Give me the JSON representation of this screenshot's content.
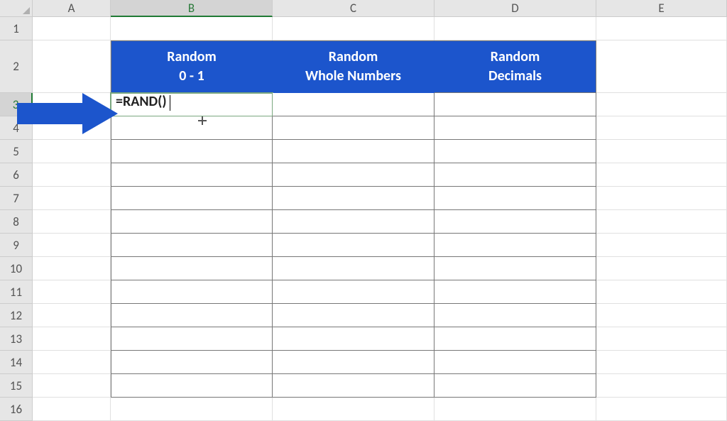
{
  "columns": {
    "A": "A",
    "B": "B",
    "C": "C",
    "D": "D",
    "E": "E"
  },
  "rows": {
    "r1": "1",
    "r2": "2",
    "r3": "3",
    "r4": "4",
    "r5": "5",
    "r6": "6",
    "r7": "7",
    "r8": "8",
    "r9": "9",
    "r10": "10",
    "r11": "11",
    "r12": "12",
    "r13": "13",
    "r14": "14",
    "r15": "15",
    "r16": "16"
  },
  "headers": {
    "B": {
      "line1": "Random",
      "line2": "0 - 1"
    },
    "C": {
      "line1": "Random",
      "line2": "Whole Numbers"
    },
    "D": {
      "line1": "Random",
      "line2": "Decimals"
    }
  },
  "active_cell": {
    "address": "B3",
    "formula": "=RAND()"
  },
  "selected_col": "B",
  "selected_row": "3",
  "colors": {
    "header_bg": "#1c55cc",
    "arrow": "#1c55cc"
  }
}
